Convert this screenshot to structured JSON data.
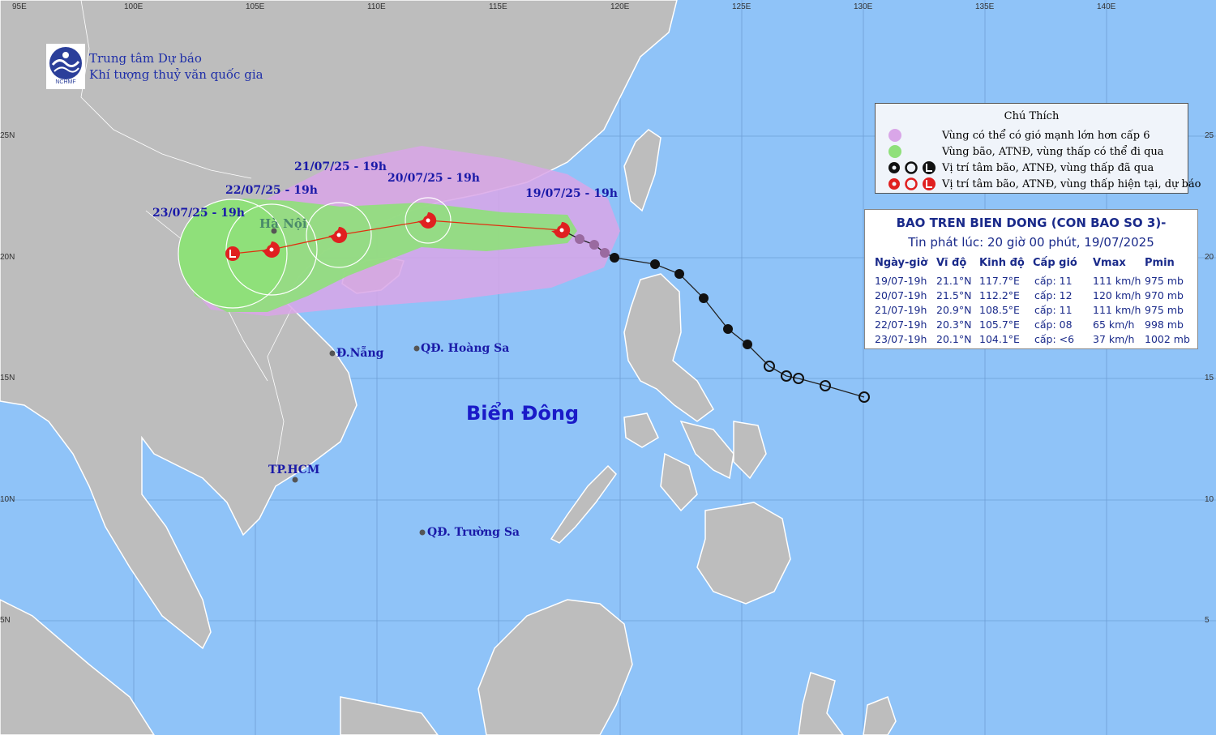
{
  "org": {
    "line1": "Trung tâm Dự báo",
    "line2": "Khí tượng thuỷ văn quốc gia",
    "logo_text": "NCHMF"
  },
  "axes": {
    "lon_top": [
      "95E",
      "100E",
      "105E",
      "110E",
      "115E",
      "120E",
      "125E",
      "130E",
      "135E",
      "140E"
    ],
    "lat_left": [
      "25N",
      "20N",
      "15N",
      "10N",
      "5N"
    ],
    "lat_right": [
      "25",
      "20",
      "15",
      "10",
      "5"
    ]
  },
  "forecast_labels": [
    "19/07/25 - 19h",
    "20/07/25 - 19h",
    "21/07/25 - 19h",
    "22/07/25 - 19h",
    "23/07/25 - 19h"
  ],
  "places": {
    "hanoi": "Hà Nội",
    "danang": "Đ.Nẵng",
    "hoangsa": "QĐ. Hoàng Sa",
    "truongsa": "QĐ. Trường Sa",
    "hcm": "TP.HCM",
    "sea": "Biển Đông"
  },
  "legend": {
    "title": "Chú Thích",
    "items": [
      {
        "text": "Vùng có thể có gió mạnh lớn hơn cấp 6",
        "color": "#d9a6e8"
      },
      {
        "text": "Vùng bão, ATNĐ, vùng thấp có thể đi qua",
        "color": "#8fe07a"
      },
      {
        "text": "Vị trí tâm bão, ATNĐ, vùng thấp đã qua",
        "symbol_color": "#111111"
      },
      {
        "text": "Vị trí tâm bão, ATNĐ, vùng thấp hiện tại, dự báo",
        "symbol_color": "#e02020"
      }
    ]
  },
  "info": {
    "title": "BAO TREN BIEN DONG (CON BAO SO 3)-",
    "issued": "Tin phát lúc: 20 giờ 00 phút, 19/07/2025",
    "headers": [
      "Ngày-giờ",
      "Vĩ độ",
      "Kinh độ",
      "Cấp gió",
      "Vmax",
      "Pmin"
    ],
    "rows": [
      [
        "19/07-19h",
        "21.1°N",
        "117.7°E",
        "cấp: 11",
        "111 km/h",
        "975 mb"
      ],
      [
        "20/07-19h",
        "21.5°N",
        "112.2°E",
        "cấp: 12",
        "120 km/h",
        "970 mb"
      ],
      [
        "21/07-19h",
        "20.9°N",
        "108.5°E",
        "cấp: 11",
        "111 km/h",
        "975 mb"
      ],
      [
        "22/07-19h",
        "20.3°N",
        "105.7°E",
        "cấp: 08",
        "65 km/h",
        "998 mb"
      ],
      [
        "23/07-19h",
        "20.1°N",
        "104.1°E",
        "cấp: <6",
        "37 km/h",
        "1002 mb"
      ]
    ]
  },
  "colors": {
    "sea": "#8fc3f8",
    "land": "#bdbdbd",
    "strong_wind": "#d9a6e8",
    "storm_area": "#8fe07a",
    "track": "#e03010"
  }
}
